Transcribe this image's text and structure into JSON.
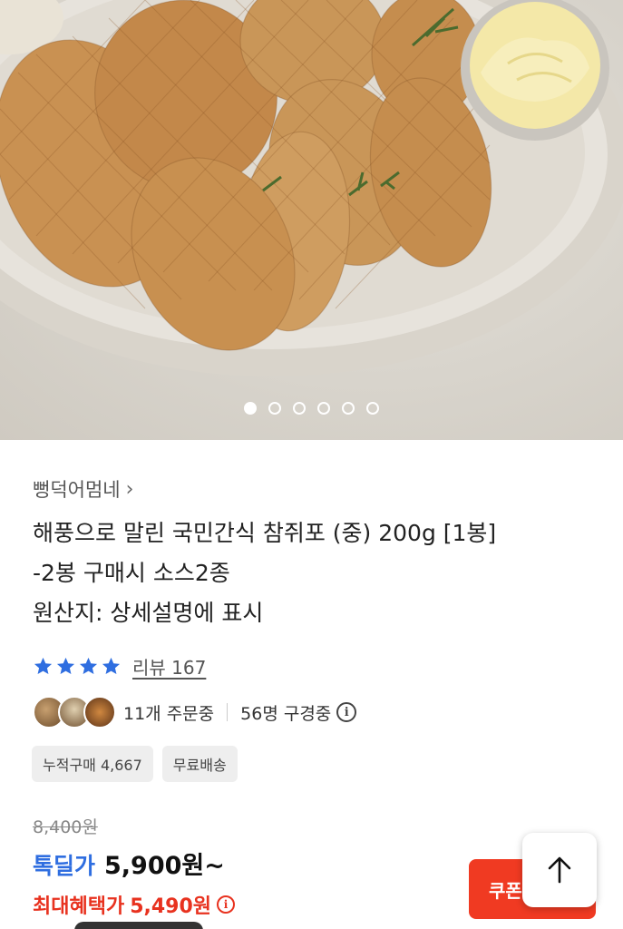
{
  "hero": {
    "image_alt": "참쥐포 plated with mayonnaise dip",
    "carousel": {
      "count": 6,
      "active_index": 0
    }
  },
  "product": {
    "seller": "뻥덕어멈네",
    "title_lines": [
      "해풍으로 말린 국민간식 참쥐포 (중) 200g [1봉]",
      "-2봉 구매시 소스2종",
      "원산지: 상세설명에 표시"
    ],
    "rating_stars": 4,
    "review_label": "리뷰 167"
  },
  "social": {
    "ordering": "11개 주문중",
    "viewing": "56명 구경중"
  },
  "chips": [
    "누적구매 4,667",
    "무료배송"
  ],
  "price": {
    "original": "8,400원",
    "deal_label": "톡딜가",
    "deal_price": "5,900원~",
    "max_label": "최대혜택가",
    "max_price": "5,490원"
  },
  "actions": {
    "coupon_label": "쿠폰"
  },
  "colors": {
    "accent_blue": "#2f6ee0",
    "accent_red": "#e8321f",
    "coupon_red": "#f03a22"
  }
}
